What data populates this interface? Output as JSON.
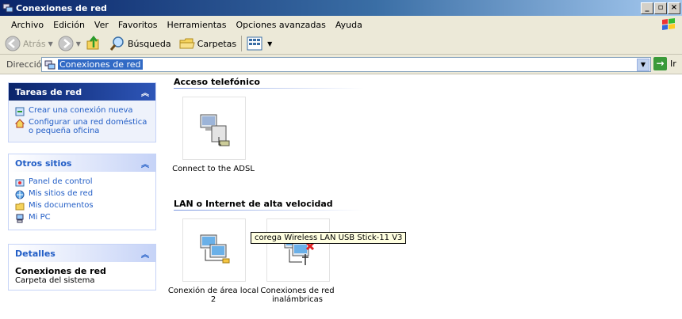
{
  "window": {
    "title": "Conexiones de red"
  },
  "menu": [
    "Archivo",
    "Edición",
    "Ver",
    "Favoritos",
    "Herramientas",
    "Opciones avanzadas",
    "Ayuda"
  ],
  "toolbar": {
    "back": "Atrás",
    "search": "Búsqueda",
    "folders": "Carpetas"
  },
  "address": {
    "label": "Dirección",
    "value": "Conexiones de red",
    "go": "Ir"
  },
  "taskpane": {
    "network_tasks": {
      "title": "Tareas de red",
      "links": [
        "Crear una conexión nueva",
        "Configurar una red doméstica o pequeña oficina"
      ]
    },
    "other_places": {
      "title": "Otros sitios",
      "links": [
        "Panel de control",
        "Mis sitios de red",
        "Mis documentos",
        "Mi PC"
      ]
    },
    "details": {
      "title": "Detalles",
      "name": "Conexiones de red",
      "type": "Carpeta del sistema"
    }
  },
  "groups": [
    {
      "title": "Acceso telefónico",
      "items": [
        "Connect to the ADSL"
      ]
    },
    {
      "title": "LAN o Internet de alta velocidad",
      "items": [
        "Conexión de área local 2",
        "Conexiones de red inalámbricas"
      ]
    }
  ],
  "tooltip": "corega Wireless LAN USB Stick-11 V3",
  "colors": {
    "title_bar": "#0a246a",
    "link": "#215dc6",
    "panel_bg": "#d6dff7",
    "tooltip_bg": "#ffffe1"
  }
}
